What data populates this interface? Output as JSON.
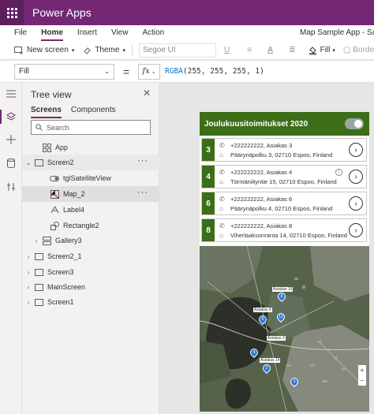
{
  "titlebar": {
    "app_name": "Power Apps"
  },
  "menu": {
    "items": [
      "File",
      "Home",
      "Insert",
      "View",
      "Action"
    ],
    "active": "Home",
    "app_title": "Map Sample App - Saved"
  },
  "toolbar": {
    "new_screen": "New screen",
    "theme": "Theme",
    "font": "Segoe UI",
    "underline": "U",
    "fill": "Fill",
    "border": "Borde"
  },
  "formula": {
    "property": "Fill",
    "equals": "=",
    "fx": "fx",
    "function": "RGBA",
    "args": "(255, 255, 255, 1)"
  },
  "rail": {
    "icons": [
      "hamburger-icon",
      "layers-icon",
      "plus-icon",
      "database-icon",
      "tools-icon"
    ]
  },
  "tree": {
    "title": "Tree view",
    "tabs": [
      "Screens",
      "Components"
    ],
    "active_tab": "Screens",
    "search_placeholder": "Search",
    "rows": [
      {
        "label": "App",
        "icon": "app-icon",
        "level": 0
      },
      {
        "label": "Screen2",
        "icon": "screen-icon",
        "level": 0,
        "expanded": true
      },
      {
        "label": "tglSatelliteView",
        "icon": "toggle-icon",
        "level": 1
      },
      {
        "label": "Map_2",
        "icon": "map-icon",
        "level": 1,
        "selected": true
      },
      {
        "label": "Label4",
        "icon": "label-icon",
        "level": 1
      },
      {
        "label": "Rectangle2",
        "icon": "shapes-icon",
        "level": 1
      },
      {
        "label": "Gallery3",
        "icon": "gallery-icon",
        "level": 1,
        "collapsed": true
      },
      {
        "label": "Screen2_1",
        "icon": "screen-icon",
        "level": 0
      },
      {
        "label": "Screen3",
        "icon": "screen-icon",
        "level": 0
      },
      {
        "label": "MainScreen",
        "icon": "screen-icon",
        "level": 0
      },
      {
        "label": "Screen1",
        "icon": "screen-icon",
        "level": 0
      }
    ],
    "more": "···"
  },
  "app": {
    "header": "Joulukuusitoimitukset 2020",
    "toggle_on": true,
    "accent": "#3c6e18",
    "deliveries": [
      {
        "num": "3",
        "contact": "+222222222, Asiakas 3",
        "address": "Päärynäpolku 3, 02710 Espoo, Finland"
      },
      {
        "num": "4",
        "contact": "+222222222, Asiakas 4",
        "address": "Törmäniityntie 15, 02710 Espoo, Finland"
      },
      {
        "num": "6",
        "contact": "+222222222, Asiakas 6",
        "address": "Päärynäpolku 4, 02710 Espoo, Finland"
      },
      {
        "num": "8",
        "contact": "+222222222, Asiakas 8",
        "address": "Viherlaaksonranta 14, 02710 Espoo, Finland"
      }
    ],
    "map_labels": [
      "Asiakas 10",
      "Asiakas 8",
      "Asiakas 3",
      "Asiakas 14"
    ],
    "map_markers": [
      "8",
      "12",
      "6",
      "4",
      "2",
      "3"
    ],
    "zoom_in": "+",
    "zoom_out": "−"
  }
}
